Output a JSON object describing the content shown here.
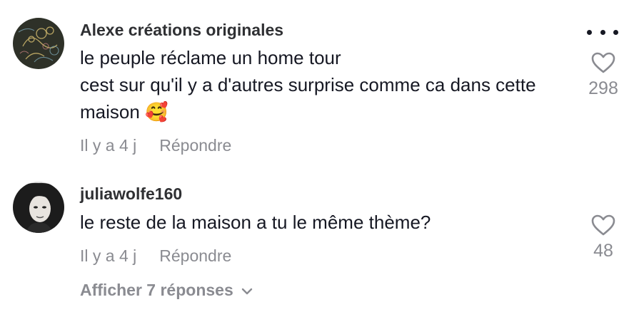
{
  "comments": [
    {
      "username": "Alexe créations originales",
      "text_line1": "le peuple réclame un home tour",
      "text_line2": "cest sur qu'il y a d'autres surprise comme ca dans cette maison",
      "emoji": "🥰",
      "time": "Il y a 4 j",
      "reply_label": "Répondre",
      "likes": "298"
    },
    {
      "username": "juliawolfe160",
      "text": "le reste de la maison a tu le même thème?",
      "time": "Il y a 4 j",
      "reply_label": "Répondre",
      "likes": "48",
      "view_replies_label": "Afficher 7 réponses"
    }
  ],
  "icons": {
    "more": "more-dots-icon",
    "like": "heart-outline-icon",
    "expand": "chevron-down-icon"
  },
  "colors": {
    "primary_text": "#161823",
    "secondary_text": "#8a8b91"
  }
}
